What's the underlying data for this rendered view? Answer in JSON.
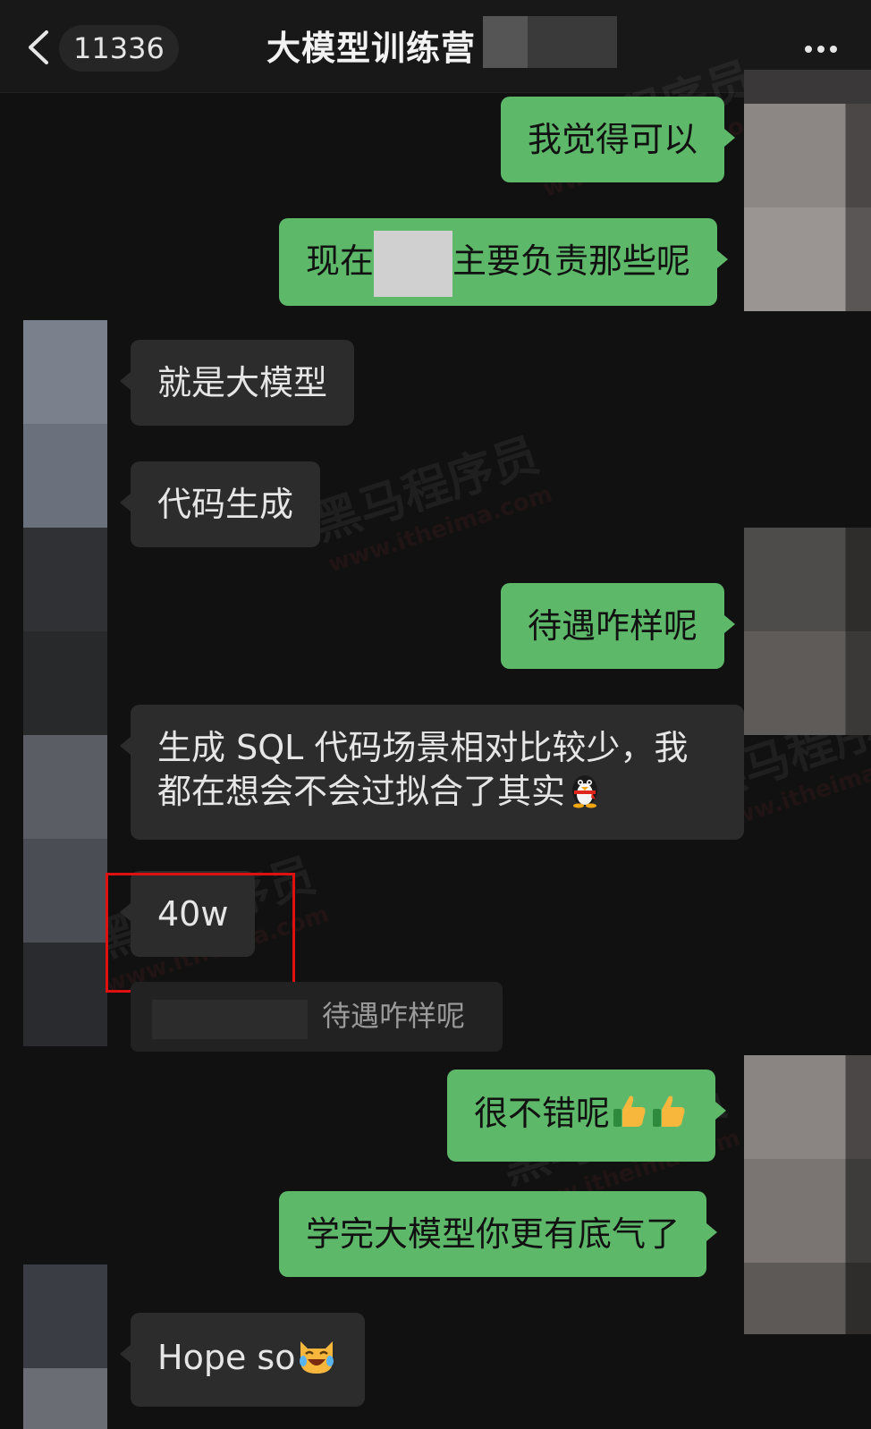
{
  "header": {
    "back_label": "11336",
    "title": "大模型训练营"
  },
  "messages": [
    {
      "id": "m1",
      "side": "out",
      "text": "我觉得可以"
    },
    {
      "id": "m2",
      "side": "out",
      "text_before": "现在",
      "text_after": "主要负责那些呢"
    },
    {
      "id": "m3",
      "side": "in",
      "text": "就是大模型"
    },
    {
      "id": "m4",
      "side": "in",
      "text": "代码生成"
    },
    {
      "id": "m5",
      "side": "out",
      "text": "待遇咋样呢"
    },
    {
      "id": "m6",
      "side": "in",
      "line1": "生成 SQL 代码场景相对比较少，我",
      "line2": "都在想会不会过拟合了其实"
    },
    {
      "id": "m7",
      "side": "in",
      "text": "40w",
      "highlighted": true
    },
    {
      "id": "m7q",
      "type": "quote",
      "text": "待遇咋样呢"
    },
    {
      "id": "m8",
      "side": "out",
      "text": "很不错呢"
    },
    {
      "id": "m9",
      "side": "out",
      "text": "学完大模型你更有底气了"
    },
    {
      "id": "m10",
      "side": "in",
      "text": "Hope so"
    }
  ],
  "colors": {
    "outgoing_bubble": "#5eb86a",
    "incoming_bubble": "#2c2c2c",
    "background": "#111111",
    "highlight_box": "#e01010"
  },
  "icons": {
    "back": "chevron-left-icon",
    "more": "more-dots-icon",
    "penguin": "qq-penguin-emoji",
    "thumbs": "thumbs-up-emoji",
    "cat": "laughing-cat-emoji"
  }
}
